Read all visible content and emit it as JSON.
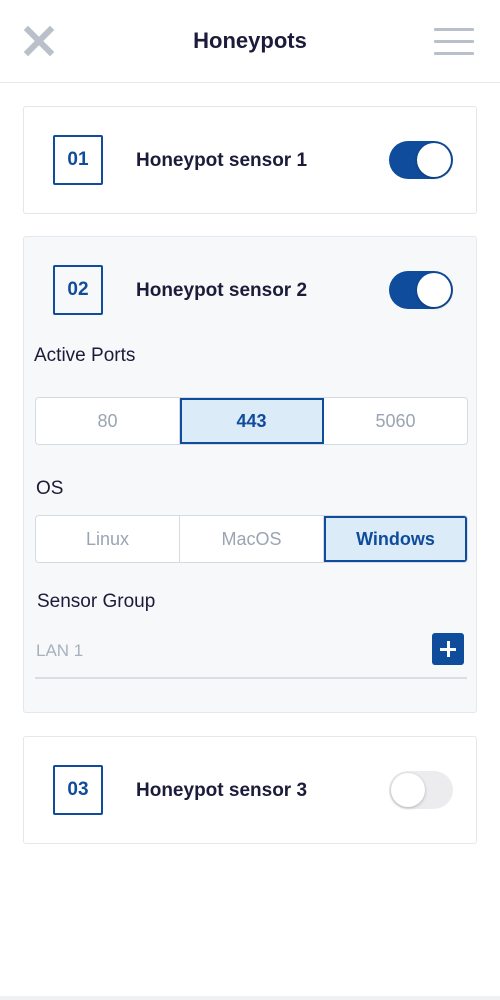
{
  "header": {
    "title": "Honeypots",
    "close_icon": "close-icon",
    "menu_icon": "hamburger-menu-icon"
  },
  "colors": {
    "accent": "#0f4c9c",
    "selected_bg": "#dcebf8",
    "title_text": "#1b1b3a",
    "muted_text": "#9aa5b3"
  },
  "sensors": [
    {
      "number": "01",
      "name": "Honeypot sensor 1",
      "enabled": true
    },
    {
      "number": "02",
      "name": "Honeypot sensor 2",
      "enabled": true,
      "active_ports": {
        "label": "Active Ports",
        "options": [
          "80",
          "443",
          "5060"
        ],
        "selected": "443"
      },
      "os": {
        "label": "OS",
        "options": [
          "Linux",
          "MacOS",
          "Windows"
        ],
        "selected": "Windows"
      },
      "sensor_group": {
        "label": "Sensor Group",
        "value": "LAN 1",
        "add_icon": "plus-icon"
      }
    },
    {
      "number": "03",
      "name": "Honeypot sensor 3",
      "enabled": false
    }
  ]
}
